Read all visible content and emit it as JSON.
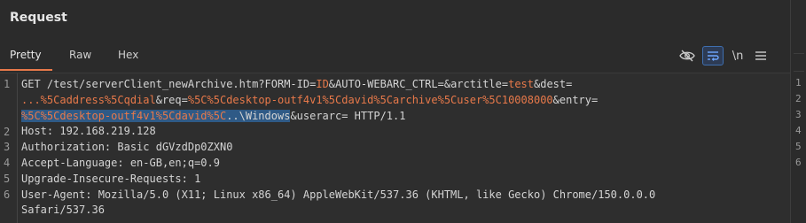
{
  "panel": {
    "title": "Request"
  },
  "tabs": [
    {
      "label": "Pretty",
      "active": true
    },
    {
      "label": "Raw",
      "active": false
    },
    {
      "label": "Hex",
      "active": false
    }
  ],
  "toolbar": {
    "newline_label": "\\n",
    "icons": [
      "eye-slash-icon",
      "wrap-icon",
      "newline-icon",
      "menu-icon"
    ]
  },
  "editor": {
    "line_numbers": [
      "1",
      "2",
      "3",
      "4",
      "5",
      "6"
    ],
    "lines": [
      {
        "segments": [
          {
            "t": "GET /test/serverClient_newArchive.htm?FORM-ID=",
            "c": "n"
          },
          {
            "t": "ID",
            "c": "p"
          },
          {
            "t": "&AUTO-WEBARC_CTRL=&arctitle=",
            "c": "n"
          },
          {
            "t": "test",
            "c": "p"
          },
          {
            "t": "&dest=",
            "c": "n"
          }
        ]
      },
      {
        "segments": [
          {
            "t": "...%5Caddress%5Cqdial",
            "c": "p"
          },
          {
            "t": "&req=",
            "c": "n"
          },
          {
            "t": "%5C%5Cdesktop-outf4v1%5Cdavid%5Carchive%5Cuser%5C10008000",
            "c": "p"
          },
          {
            "t": "&entry=",
            "c": "n"
          }
        ]
      },
      {
        "segments": [
          {
            "t": "%5C%5Cdesktop-outf4v1%5Cdavid%5C",
            "c": "ps"
          },
          {
            "t": "..\\Windows",
            "c": "ns"
          },
          {
            "t": "&userarc= HTTP/1.1",
            "c": "n"
          }
        ]
      },
      {
        "segments": [
          {
            "t": "Host: 192.168.219.128",
            "c": "n"
          }
        ]
      },
      {
        "segments": [
          {
            "t": "Authorization: Basic dGVzdDp0ZXN0",
            "c": "n"
          }
        ]
      },
      {
        "segments": [
          {
            "t": "Accept-Language: en-GB,en;q=0.9",
            "c": "n"
          }
        ]
      },
      {
        "segments": [
          {
            "t": "Upgrade-Insecure-Requests: 1",
            "c": "n"
          }
        ]
      },
      {
        "segments": [
          {
            "t": "User-Agent: Mozilla/5.0 (X11; Linux x86_64) AppleWebKit/537.36 (KHTML, like Gecko) Chrome/150.0.0.0",
            "c": "n"
          }
        ]
      },
      {
        "segments": [
          {
            "t": "Safari/537.36",
            "c": "n"
          }
        ]
      }
    ]
  },
  "side_strip": {
    "line_numbers": [
      "1",
      "2",
      "3",
      "4",
      "5",
      "6"
    ]
  },
  "colors": {
    "accent": "#e8794a",
    "selection": "#2f5a86",
    "background": "#2b2b2b"
  }
}
